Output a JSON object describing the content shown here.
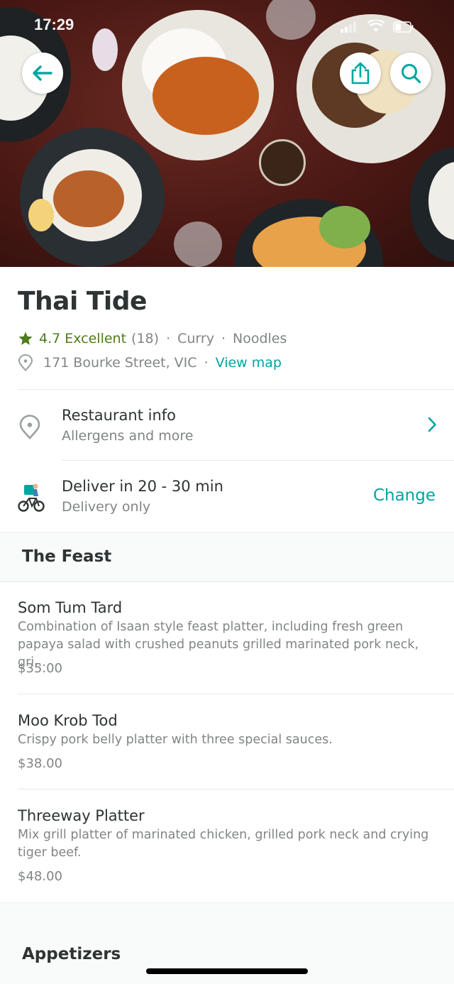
{
  "status_bar": {
    "time": "17:29"
  },
  "restaurant": {
    "name": "Thai Tide",
    "rating": "4.7 Excellent",
    "rating_count": "(18)",
    "tags": [
      "Curry",
      "Noodles"
    ],
    "address": "171 Bourke Street, VIC",
    "view_map_label": "View map"
  },
  "info": {
    "title": "Restaurant info",
    "subtitle": "Allergens and more"
  },
  "delivery": {
    "title": "Deliver in 20 - 30 min",
    "subtitle": "Delivery only",
    "change_label": "Change"
  },
  "sections": [
    {
      "title": "The Feast",
      "items": [
        {
          "name": "Som Tum Tard",
          "description": "Combination of Isaan style feast platter, including fresh green papaya salad with crushed peanuts grilled marinated pork neck, gri...",
          "price": "$35.00"
        },
        {
          "name": "Moo Krob Tod",
          "description": "Crispy pork belly platter with three special sauces.",
          "price": "$38.00"
        },
        {
          "name": "Threeway Platter",
          "description": "Mix grill platter of marinated chicken, grilled pork neck and crying tiger beef.",
          "price": "$48.00"
        }
      ]
    },
    {
      "title": "Appetizers"
    }
  ],
  "colors": {
    "accent": "#00a6a0",
    "rating_green": "#4d7c1b",
    "text_primary": "#2e3333",
    "text_secondary": "#828585"
  },
  "icons": {
    "back": "arrow-left-icon",
    "share": "share-icon",
    "search": "search-icon",
    "star": "star-icon",
    "location": "location-pin-icon",
    "chevron": "chevron-right-icon",
    "rider": "delivery-rider-icon"
  }
}
